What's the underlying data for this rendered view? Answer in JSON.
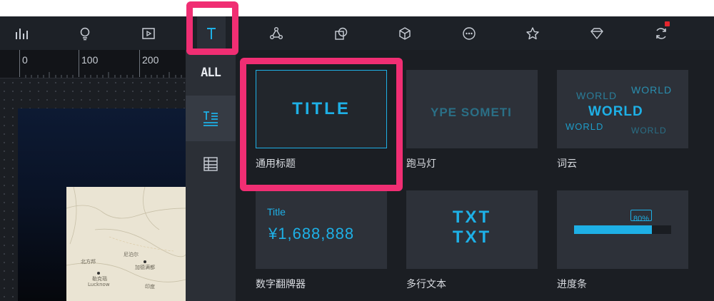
{
  "toolbar": {
    "buttons": [
      {
        "name": "chart-icon"
      },
      {
        "name": "bulb-icon"
      },
      {
        "name": "media-icon"
      },
      {
        "name": "text-icon",
        "active": true
      },
      {
        "name": "network-icon"
      },
      {
        "name": "shapes-icon"
      },
      {
        "name": "cube-icon"
      },
      {
        "name": "more-icon"
      },
      {
        "name": "star-icon"
      },
      {
        "name": "diamond-icon"
      },
      {
        "name": "sync-icon",
        "badge": true
      }
    ]
  },
  "ruler": {
    "labels": [
      "0",
      "100",
      "200"
    ]
  },
  "map": {
    "labels": [
      "尼泊尔",
      "加德满都",
      "勒克瑙",
      "Lucknow",
      "北方邦",
      "印度"
    ]
  },
  "categories": {
    "items": [
      {
        "id": "all",
        "label": "ALL"
      },
      {
        "id": "text",
        "icon": "text-list-icon",
        "active": true
      },
      {
        "id": "table",
        "icon": "table-icon"
      }
    ]
  },
  "widgets": [
    {
      "id": "general-title",
      "label": "通用标题",
      "preview": "TITLE"
    },
    {
      "id": "marquee",
      "label": "跑马灯",
      "preview": "YPE SOMETI"
    },
    {
      "id": "wordcloud",
      "label": "词云",
      "preview_words": [
        "WORLD",
        "WORLD",
        "WORLD",
        "WORLD",
        "WORLD"
      ]
    },
    {
      "id": "flip-number",
      "label": "数字翻牌器",
      "preview_title": "Title",
      "preview_value": "¥1,688,888"
    },
    {
      "id": "multiline-text",
      "label": "多行文本",
      "preview_lines": [
        "TXT",
        "TXT"
      ]
    },
    {
      "id": "progress",
      "label": "进度条",
      "preview_value": "80%",
      "progress": 0.8
    }
  ],
  "colors": {
    "accent": "#1eb0e6",
    "highlight": "#f02e73",
    "toolbar_bg": "#1d2127",
    "card_bg": "#2d3139"
  }
}
